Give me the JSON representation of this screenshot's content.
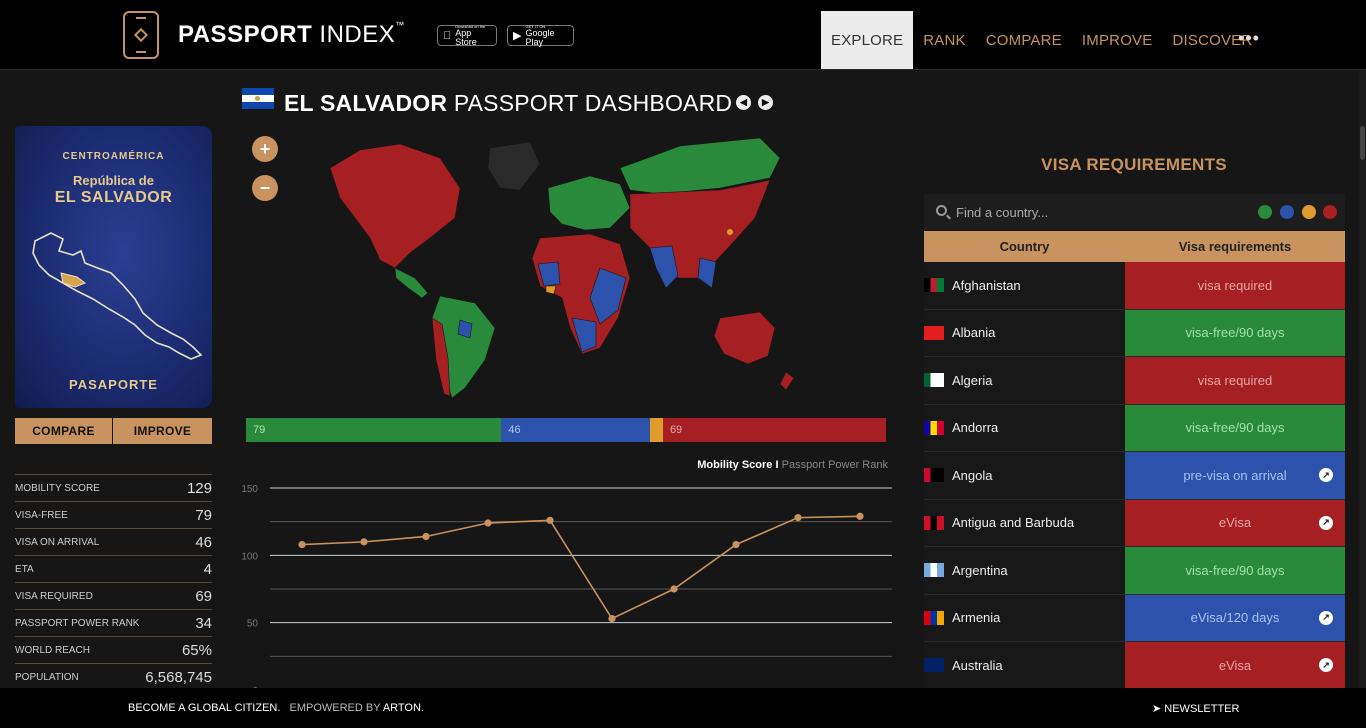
{
  "header": {
    "brand_bold": "PASSPORT",
    "brand_light": "INDEX",
    "brand_tm": "™",
    "appstore_small": "Download on the",
    "appstore_big": "App Store",
    "gplay_small": "GET IT ON",
    "gplay_big": "Google Play",
    "nav": [
      "EXPLORE",
      "RANK",
      "COMPARE",
      "IMPROVE",
      "DISCOVER"
    ],
    "more": "•••"
  },
  "passport": {
    "line1": "CENTROAMÉRICA",
    "line2": "República de",
    "line3": "EL SALVADOR",
    "line4": "PASAPORTE"
  },
  "buttons": {
    "compare": "COMPARE",
    "improve": "IMPROVE"
  },
  "stats": [
    {
      "label": "MOBILITY SCORE",
      "value": "129"
    },
    {
      "label": "VISA-FREE",
      "value": "79"
    },
    {
      "label": "VISA ON ARRIVAL",
      "value": "46"
    },
    {
      "label": "ETA",
      "value": "4"
    },
    {
      "label": "VISA REQUIRED",
      "value": "69"
    },
    {
      "label": "PASSPORT POWER RANK",
      "value": "34"
    },
    {
      "label": "WORLD REACH",
      "value": "65%"
    },
    {
      "label": "POPULATION",
      "value": "6,568,745"
    }
  ],
  "dashboard": {
    "title_bold": "EL SALVADOR",
    "title_rest": "PASSPORT DASHBOARD",
    "zoom_in": "+",
    "zoom_out": "−",
    "prev": "◀",
    "next": "▶"
  },
  "breakdown": [
    {
      "label": "79",
      "value": 79,
      "color": "#2a8a3c",
      "text": "#a8e0ae"
    },
    {
      "label": "46",
      "value": 46,
      "color": "#2d52ab",
      "text": "#b6c8f2"
    },
    {
      "label": "",
      "value": 4,
      "color": "#e09b2d",
      "text": "#000"
    },
    {
      "label": "69",
      "value": 69,
      "color": "#a51f23",
      "text": "#eaa7a7"
    }
  ],
  "chart_legend": {
    "active": "Mobility Score",
    "sep": "I",
    "inactive": "Passport Power Rank"
  },
  "chart_data": {
    "type": "line",
    "series": [
      {
        "values": [
          108,
          110,
          114,
          124,
          126,
          53,
          75,
          108,
          128,
          129
        ]
      }
    ],
    "ylim": [
      0,
      150
    ],
    "yticks": [
      "150",
      "100",
      "50",
      "0"
    ],
    "line_color": "#c8935f",
    "grid": true
  },
  "visa": {
    "title": "VISA REQUIREMENTS",
    "search_placeholder": "Find a country...",
    "filter_colors": [
      "#2a8a3c",
      "#2d52ab",
      "#e09b2d",
      "#a51f23"
    ],
    "col_country": "Country",
    "col_req": "Visa requirements",
    "rows": [
      {
        "country": "Afghanistan",
        "req": "visa required",
        "status": "red",
        "ext": false,
        "flag": [
          "#000000",
          "#b8212a",
          "#007a36"
        ]
      },
      {
        "country": "Albania",
        "req": "visa-free/90 days",
        "status": "green",
        "ext": false,
        "flag": [
          "#e41e20",
          "#e41e20",
          "#e41e20"
        ]
      },
      {
        "country": "Algeria",
        "req": "visa required",
        "status": "red",
        "ext": false,
        "flag": [
          "#006233",
          "#ffffff",
          "#ffffff"
        ]
      },
      {
        "country": "Andorra",
        "req": "visa-free/90 days",
        "status": "green",
        "ext": false,
        "flag": [
          "#10069f",
          "#fedd00",
          "#d50032"
        ]
      },
      {
        "country": "Angola",
        "req": "pre-visa on arrival",
        "status": "blue",
        "ext": true,
        "flag": [
          "#cc092f",
          "#000000",
          "#000000"
        ]
      },
      {
        "country": "Antigua and Barbuda",
        "req": "eVisa",
        "status": "red",
        "ext": true,
        "flag": [
          "#ce1126",
          "#000000",
          "#ce1126"
        ]
      },
      {
        "country": "Argentina",
        "req": "visa-free/90 days",
        "status": "green",
        "ext": false,
        "flag": [
          "#74acdf",
          "#ffffff",
          "#74acdf"
        ]
      },
      {
        "country": "Armenia",
        "req": "eVisa/120 days",
        "status": "blue",
        "ext": true,
        "flag": [
          "#d90012",
          "#0033a0",
          "#f2a800"
        ]
      },
      {
        "country": "Australia",
        "req": "eVisa",
        "status": "red",
        "ext": true,
        "flag": [
          "#012169",
          "#012169",
          "#012169"
        ]
      }
    ]
  },
  "footer": {
    "slogan": "BECOME A GLOBAL CITIZEN.",
    "empowered": "EMPOWERED BY",
    "arton": "ARTON.",
    "newsletter": "NEWSLETTER"
  }
}
